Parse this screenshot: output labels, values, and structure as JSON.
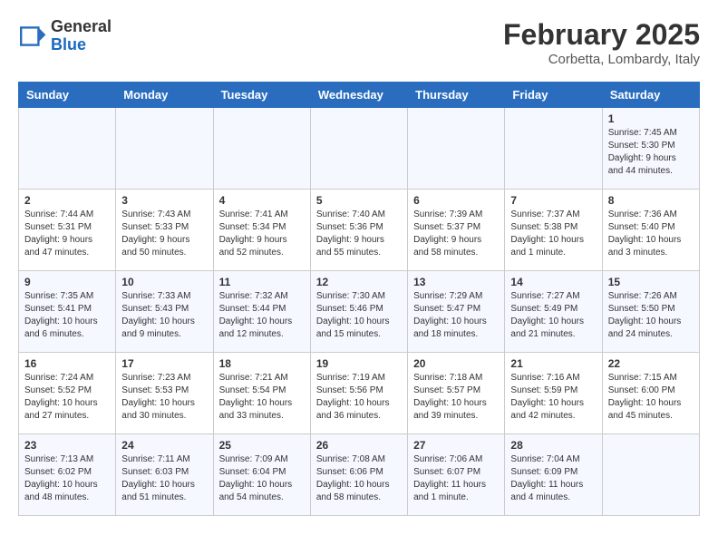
{
  "header": {
    "logo_general": "General",
    "logo_blue": "Blue",
    "month_title": "February 2025",
    "location": "Corbetta, Lombardy, Italy"
  },
  "columns": [
    "Sunday",
    "Monday",
    "Tuesday",
    "Wednesday",
    "Thursday",
    "Friday",
    "Saturday"
  ],
  "weeks": [
    [
      {
        "day": "",
        "info": ""
      },
      {
        "day": "",
        "info": ""
      },
      {
        "day": "",
        "info": ""
      },
      {
        "day": "",
        "info": ""
      },
      {
        "day": "",
        "info": ""
      },
      {
        "day": "",
        "info": ""
      },
      {
        "day": "1",
        "info": "Sunrise: 7:45 AM\nSunset: 5:30 PM\nDaylight: 9 hours\nand 44 minutes."
      }
    ],
    [
      {
        "day": "2",
        "info": "Sunrise: 7:44 AM\nSunset: 5:31 PM\nDaylight: 9 hours\nand 47 minutes."
      },
      {
        "day": "3",
        "info": "Sunrise: 7:43 AM\nSunset: 5:33 PM\nDaylight: 9 hours\nand 50 minutes."
      },
      {
        "day": "4",
        "info": "Sunrise: 7:41 AM\nSunset: 5:34 PM\nDaylight: 9 hours\nand 52 minutes."
      },
      {
        "day": "5",
        "info": "Sunrise: 7:40 AM\nSunset: 5:36 PM\nDaylight: 9 hours\nand 55 minutes."
      },
      {
        "day": "6",
        "info": "Sunrise: 7:39 AM\nSunset: 5:37 PM\nDaylight: 9 hours\nand 58 minutes."
      },
      {
        "day": "7",
        "info": "Sunrise: 7:37 AM\nSunset: 5:38 PM\nDaylight: 10 hours\nand 1 minute."
      },
      {
        "day": "8",
        "info": "Sunrise: 7:36 AM\nSunset: 5:40 PM\nDaylight: 10 hours\nand 3 minutes."
      }
    ],
    [
      {
        "day": "9",
        "info": "Sunrise: 7:35 AM\nSunset: 5:41 PM\nDaylight: 10 hours\nand 6 minutes."
      },
      {
        "day": "10",
        "info": "Sunrise: 7:33 AM\nSunset: 5:43 PM\nDaylight: 10 hours\nand 9 minutes."
      },
      {
        "day": "11",
        "info": "Sunrise: 7:32 AM\nSunset: 5:44 PM\nDaylight: 10 hours\nand 12 minutes."
      },
      {
        "day": "12",
        "info": "Sunrise: 7:30 AM\nSunset: 5:46 PM\nDaylight: 10 hours\nand 15 minutes."
      },
      {
        "day": "13",
        "info": "Sunrise: 7:29 AM\nSunset: 5:47 PM\nDaylight: 10 hours\nand 18 minutes."
      },
      {
        "day": "14",
        "info": "Sunrise: 7:27 AM\nSunset: 5:49 PM\nDaylight: 10 hours\nand 21 minutes."
      },
      {
        "day": "15",
        "info": "Sunrise: 7:26 AM\nSunset: 5:50 PM\nDaylight: 10 hours\nand 24 minutes."
      }
    ],
    [
      {
        "day": "16",
        "info": "Sunrise: 7:24 AM\nSunset: 5:52 PM\nDaylight: 10 hours\nand 27 minutes."
      },
      {
        "day": "17",
        "info": "Sunrise: 7:23 AM\nSunset: 5:53 PM\nDaylight: 10 hours\nand 30 minutes."
      },
      {
        "day": "18",
        "info": "Sunrise: 7:21 AM\nSunset: 5:54 PM\nDaylight: 10 hours\nand 33 minutes."
      },
      {
        "day": "19",
        "info": "Sunrise: 7:19 AM\nSunset: 5:56 PM\nDaylight: 10 hours\nand 36 minutes."
      },
      {
        "day": "20",
        "info": "Sunrise: 7:18 AM\nSunset: 5:57 PM\nDaylight: 10 hours\nand 39 minutes."
      },
      {
        "day": "21",
        "info": "Sunrise: 7:16 AM\nSunset: 5:59 PM\nDaylight: 10 hours\nand 42 minutes."
      },
      {
        "day": "22",
        "info": "Sunrise: 7:15 AM\nSunset: 6:00 PM\nDaylight: 10 hours\nand 45 minutes."
      }
    ],
    [
      {
        "day": "23",
        "info": "Sunrise: 7:13 AM\nSunset: 6:02 PM\nDaylight: 10 hours\nand 48 minutes."
      },
      {
        "day": "24",
        "info": "Sunrise: 7:11 AM\nSunset: 6:03 PM\nDaylight: 10 hours\nand 51 minutes."
      },
      {
        "day": "25",
        "info": "Sunrise: 7:09 AM\nSunset: 6:04 PM\nDaylight: 10 hours\nand 54 minutes."
      },
      {
        "day": "26",
        "info": "Sunrise: 7:08 AM\nSunset: 6:06 PM\nDaylight: 10 hours\nand 58 minutes."
      },
      {
        "day": "27",
        "info": "Sunrise: 7:06 AM\nSunset: 6:07 PM\nDaylight: 11 hours\nand 1 minute."
      },
      {
        "day": "28",
        "info": "Sunrise: 7:04 AM\nSunset: 6:09 PM\nDaylight: 11 hours\nand 4 minutes."
      },
      {
        "day": "",
        "info": ""
      }
    ]
  ]
}
